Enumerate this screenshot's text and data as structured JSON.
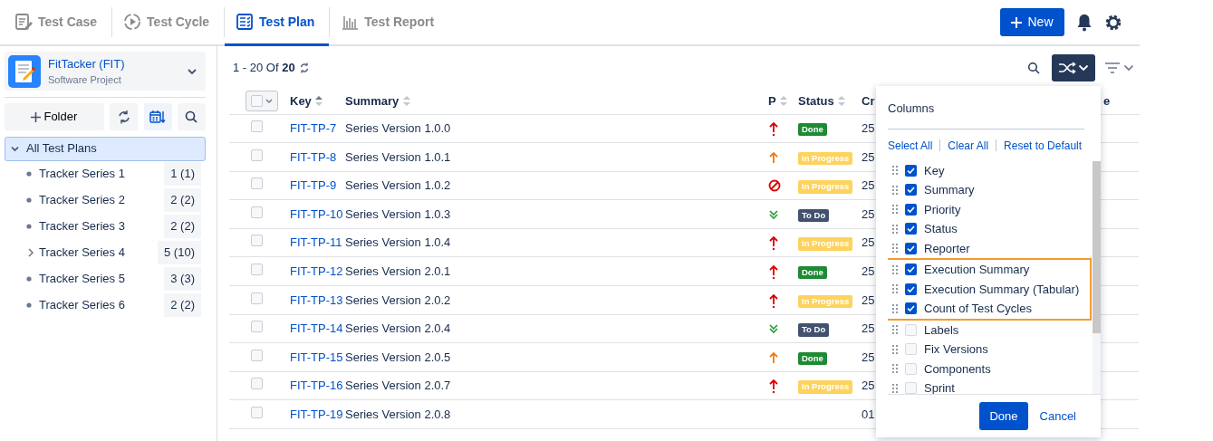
{
  "nav_tabs": [
    {
      "label": "Test Case",
      "kind": "case",
      "selected": false
    },
    {
      "label": "Test Cycle",
      "kind": "cycle",
      "selected": false
    },
    {
      "label": "Test Plan",
      "kind": "plan",
      "selected": true
    },
    {
      "label": "Test Report",
      "kind": "report",
      "selected": false
    }
  ],
  "new_button": "New",
  "project": {
    "name": "FitTacker (FIT)",
    "type": "Software Project"
  },
  "folder_button": "Folder",
  "tree": {
    "label": "All Test Plans",
    "selected": true,
    "expanded": true,
    "children": [
      {
        "label": "Tracker Series 1",
        "count": "1 (1)",
        "kind": "leaf"
      },
      {
        "label": "Tracker Series 2",
        "count": "2 (2)",
        "kind": "leaf"
      },
      {
        "label": "Tracker Series 3",
        "count": "2 (2)",
        "kind": "leaf"
      },
      {
        "label": "Tracker Series 4",
        "count": "5 (10)",
        "kind": "folder",
        "expanded": false
      },
      {
        "label": "Tracker Series 5",
        "count": "3 (3)",
        "kind": "leaf"
      },
      {
        "label": "Tracker Series 6",
        "count": "2 (2)",
        "kind": "leaf"
      }
    ]
  },
  "pagination": "1 - 20 Of **20**",
  "table": {
    "select_all_checked": false,
    "columns": [
      "Key",
      "Summary",
      "P",
      "Status",
      "Cr",
      "e"
    ],
    "rows": [
      {
        "key": "FIT-TP-7",
        "summary": "Series Version 1.0.0",
        "priority": {
          "kind": "highest"
        },
        "status": {
          "label": "Done",
          "kind": "done"
        },
        "column_5": "25",
        "checked": false
      },
      {
        "key": "FIT-TP-8",
        "summary": "Series Version 1.0.1",
        "priority": {
          "kind": "high"
        },
        "status": {
          "label": "In Progress",
          "kind": "progress"
        },
        "column_5": "25",
        "checked": false
      },
      {
        "key": "FIT-TP-9",
        "summary": "Series Version 1.0.2",
        "priority": {
          "kind": "blocker"
        },
        "status": {
          "label": "In Progress",
          "kind": "progress"
        },
        "column_5": "25",
        "checked": false
      },
      {
        "key": "FIT-TP-10",
        "summary": "Series Version 1.0.3",
        "priority": {
          "kind": "lowest"
        },
        "status": {
          "label": "To Do",
          "kind": "todo"
        },
        "column_5": "25",
        "checked": false
      },
      {
        "key": "FIT-TP-11",
        "summary": "Series Version 1.0.4",
        "priority": {
          "kind": "highest"
        },
        "status": {
          "label": "In Progress",
          "kind": "progress"
        },
        "column_5": "25",
        "checked": false
      },
      {
        "key": "FIT-TP-12",
        "summary": "Series Version 2.0.1",
        "priority": {
          "kind": "highest"
        },
        "status": {
          "label": "Done",
          "kind": "done"
        },
        "column_5": "25",
        "checked": false
      },
      {
        "key": "FIT-TP-13",
        "summary": "Series Version 2.0.2",
        "priority": {
          "kind": "highest"
        },
        "status": {
          "label": "In Progress",
          "kind": "progress"
        },
        "column_5": "25",
        "checked": false
      },
      {
        "key": "FIT-TP-14",
        "summary": "Series Version 2.0.4",
        "priority": {
          "kind": "lowest"
        },
        "status": {
          "label": "To Do",
          "kind": "todo"
        },
        "column_5": "25",
        "checked": false
      },
      {
        "key": "FIT-TP-15",
        "summary": "Series Version 2.0.5",
        "priority": {
          "kind": "high"
        },
        "status": {
          "label": "Done",
          "kind": "done"
        },
        "column_5": "25",
        "checked": false
      },
      {
        "key": "FIT-TP-16",
        "summary": "Series Version 2.0.7",
        "priority": {
          "kind": "highest"
        },
        "status": {
          "label": "In Progress",
          "kind": "progress"
        },
        "column_5": "25",
        "checked": false
      },
      {
        "key": "FIT-TP-19",
        "summary": "Series Version 2.0.8",
        "column_5": "01",
        "checked": false
      }
    ]
  },
  "columns_menu": {
    "title": "Columns",
    "actions": [
      "Select All",
      "Clear All",
      "Reset to Default"
    ],
    "items": [
      {
        "label": "Key",
        "checked": true,
        "highlighted": false
      },
      {
        "label": "Summary",
        "checked": true,
        "highlighted": false
      },
      {
        "label": "Priority",
        "checked": true,
        "highlighted": false
      },
      {
        "label": "Status",
        "checked": true,
        "highlighted": false
      },
      {
        "label": "Reporter",
        "checked": true,
        "highlighted": false
      },
      {
        "label": "Execution Summary",
        "checked": true,
        "highlighted": true
      },
      {
        "label": "Execution Summary (Tabular)",
        "checked": true,
        "highlighted": true
      },
      {
        "label": "Count of Test Cycles",
        "checked": true,
        "highlighted": true
      },
      {
        "label": "Labels",
        "checked": false,
        "highlighted": false
      },
      {
        "label": "Fix Versions",
        "checked": false,
        "highlighted": false
      },
      {
        "label": "Components",
        "checked": false,
        "highlighted": false
      },
      {
        "label": "Sprint",
        "checked": false,
        "highlighted": false
      }
    ],
    "done": "Done",
    "cancel": "Cancel"
  }
}
